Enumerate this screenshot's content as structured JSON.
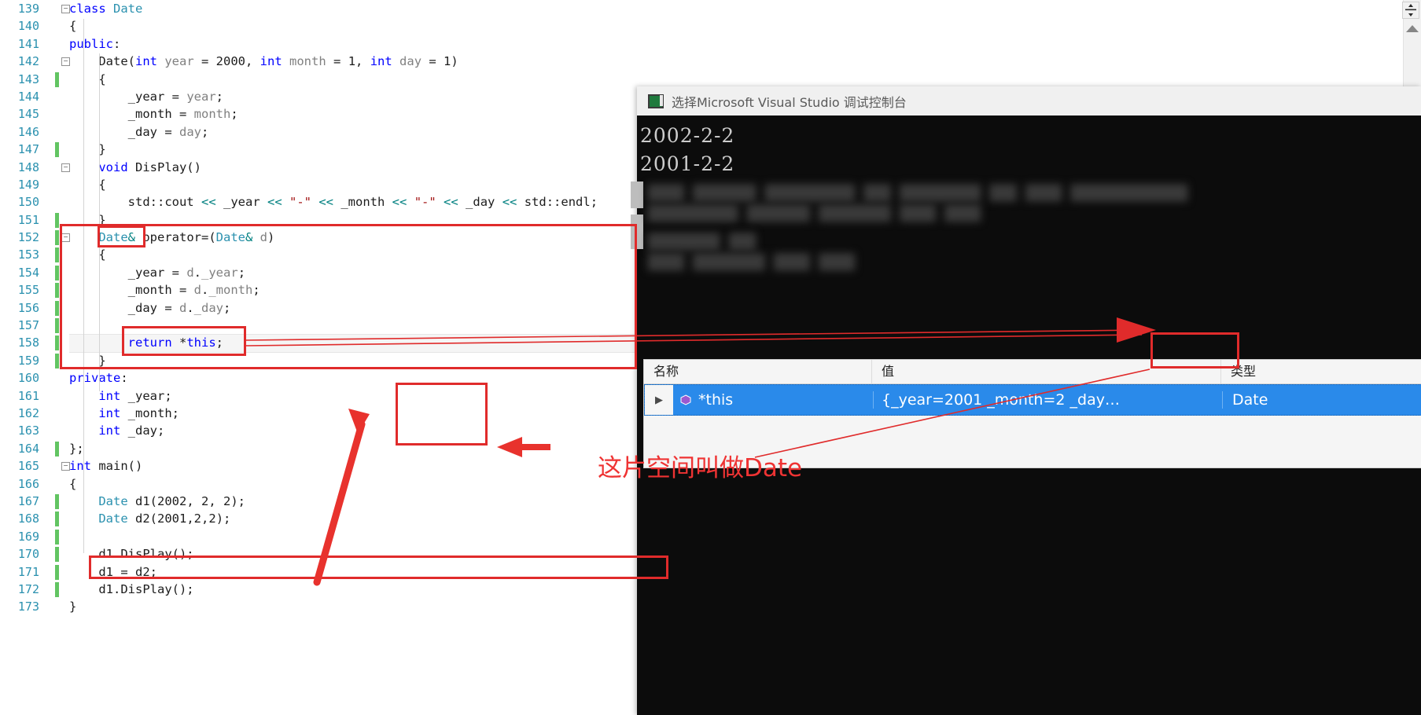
{
  "editor": {
    "first_line_number": 139,
    "lines": [
      {
        "n": 139,
        "fold": "minus",
        "change": false,
        "tokens": [
          {
            "t": "class ",
            "c": "kw"
          },
          {
            "t": "Date",
            "c": "type"
          }
        ]
      },
      {
        "n": 140,
        "fold": null,
        "change": false,
        "tokens": [
          {
            "t": "{",
            "c": "plain"
          }
        ]
      },
      {
        "n": 141,
        "fold": null,
        "change": false,
        "tokens": [
          {
            "t": "public",
            "c": "kw"
          },
          {
            "t": ":",
            "c": "plain"
          }
        ]
      },
      {
        "n": 142,
        "fold": "minus",
        "change": false,
        "indent": 2,
        "tokens": [
          {
            "t": "Date",
            "c": "plain"
          },
          {
            "t": "(",
            "c": "plain"
          },
          {
            "t": "int",
            "c": "kw"
          },
          {
            "t": " ",
            "c": "plain"
          },
          {
            "t": "year",
            "c": "param"
          },
          {
            "t": " = ",
            "c": "plain"
          },
          {
            "t": "2000",
            "c": "num"
          },
          {
            "t": ", ",
            "c": "plain"
          },
          {
            "t": "int",
            "c": "kw"
          },
          {
            "t": " ",
            "c": "plain"
          },
          {
            "t": "month",
            "c": "param"
          },
          {
            "t": " = ",
            "c": "plain"
          },
          {
            "t": "1",
            "c": "num"
          },
          {
            "t": ", ",
            "c": "plain"
          },
          {
            "t": "int",
            "c": "kw"
          },
          {
            "t": " ",
            "c": "plain"
          },
          {
            "t": "day",
            "c": "param"
          },
          {
            "t": " = ",
            "c": "plain"
          },
          {
            "t": "1",
            "c": "num"
          },
          {
            "t": ")",
            "c": "plain"
          }
        ]
      },
      {
        "n": 143,
        "fold": null,
        "change": true,
        "indent": 2,
        "tokens": [
          {
            "t": "{",
            "c": "plain"
          }
        ]
      },
      {
        "n": 144,
        "fold": null,
        "change": false,
        "indent": 4,
        "tokens": [
          {
            "t": "_year",
            "c": "plain"
          },
          {
            "t": " = ",
            "c": "plain"
          },
          {
            "t": "year",
            "c": "param"
          },
          {
            "t": ";",
            "c": "plain"
          }
        ]
      },
      {
        "n": 145,
        "fold": null,
        "change": false,
        "indent": 4,
        "tokens": [
          {
            "t": "_month",
            "c": "plain"
          },
          {
            "t": " = ",
            "c": "plain"
          },
          {
            "t": "month",
            "c": "param"
          },
          {
            "t": ";",
            "c": "plain"
          }
        ]
      },
      {
        "n": 146,
        "fold": null,
        "change": false,
        "indent": 4,
        "tokens": [
          {
            "t": "_day",
            "c": "plain"
          },
          {
            "t": " = ",
            "c": "plain"
          },
          {
            "t": "day",
            "c": "param"
          },
          {
            "t": ";",
            "c": "plain"
          }
        ]
      },
      {
        "n": 147,
        "fold": null,
        "change": true,
        "indent": 2,
        "tokens": [
          {
            "t": "}",
            "c": "plain"
          }
        ]
      },
      {
        "n": 148,
        "fold": "minus",
        "change": false,
        "indent": 2,
        "tokens": [
          {
            "t": "void",
            "c": "kw"
          },
          {
            "t": " DisPlay()",
            "c": "plain"
          }
        ]
      },
      {
        "n": 149,
        "fold": null,
        "change": false,
        "indent": 2,
        "tokens": [
          {
            "t": "{",
            "c": "plain"
          }
        ]
      },
      {
        "n": 150,
        "fold": null,
        "change": false,
        "indent": 4,
        "tokens": [
          {
            "t": "std::cout ",
            "c": "plain"
          },
          {
            "t": "<<",
            "c": "op"
          },
          {
            "t": " _year ",
            "c": "plain"
          },
          {
            "t": "<<",
            "c": "op"
          },
          {
            "t": " ",
            "c": "plain"
          },
          {
            "t": "\"-\"",
            "c": "str"
          },
          {
            "t": " ",
            "c": "plain"
          },
          {
            "t": "<<",
            "c": "op"
          },
          {
            "t": " _month ",
            "c": "plain"
          },
          {
            "t": "<<",
            "c": "op"
          },
          {
            "t": " ",
            "c": "plain"
          },
          {
            "t": "\"-\"",
            "c": "str"
          },
          {
            "t": " ",
            "c": "plain"
          },
          {
            "t": "<<",
            "c": "op"
          },
          {
            "t": " _day ",
            "c": "plain"
          },
          {
            "t": "<<",
            "c": "op"
          },
          {
            "t": " std::endl;",
            "c": "plain"
          }
        ]
      },
      {
        "n": 151,
        "fold": null,
        "change": true,
        "indent": 2,
        "tokens": [
          {
            "t": "}",
            "c": "plain"
          }
        ]
      },
      {
        "n": 152,
        "fold": "minus",
        "change": true,
        "indent": 2,
        "tokens": [
          {
            "t": "Date",
            "c": "type"
          },
          {
            "t": "&",
            "c": "op"
          },
          {
            "t": " operator=(",
            "c": "plain"
          },
          {
            "t": "Date",
            "c": "type"
          },
          {
            "t": "&",
            "c": "op"
          },
          {
            "t": " ",
            "c": "plain"
          },
          {
            "t": "d",
            "c": "param"
          },
          {
            "t": ")",
            "c": "plain"
          }
        ]
      },
      {
        "n": 153,
        "fold": null,
        "change": true,
        "indent": 2,
        "tokens": [
          {
            "t": "{",
            "c": "plain"
          }
        ]
      },
      {
        "n": 154,
        "fold": null,
        "change": true,
        "indent": 4,
        "tokens": [
          {
            "t": "_year",
            "c": "plain"
          },
          {
            "t": " = ",
            "c": "plain"
          },
          {
            "t": "d",
            "c": "param"
          },
          {
            "t": ".",
            "c": "plain"
          },
          {
            "t": "_year",
            "c": "param"
          },
          {
            "t": ";",
            "c": "plain"
          }
        ]
      },
      {
        "n": 155,
        "fold": null,
        "change": true,
        "indent": 4,
        "tokens": [
          {
            "t": "_month",
            "c": "plain"
          },
          {
            "t": " = ",
            "c": "plain"
          },
          {
            "t": "d",
            "c": "param"
          },
          {
            "t": ".",
            "c": "plain"
          },
          {
            "t": "_month",
            "c": "param"
          },
          {
            "t": ";",
            "c": "plain"
          }
        ]
      },
      {
        "n": 156,
        "fold": null,
        "change": true,
        "indent": 4,
        "tokens": [
          {
            "t": "_day",
            "c": "plain"
          },
          {
            "t": " = ",
            "c": "plain"
          },
          {
            "t": "d",
            "c": "param"
          },
          {
            "t": ".",
            "c": "plain"
          },
          {
            "t": "_day",
            "c": "param"
          },
          {
            "t": ";",
            "c": "plain"
          }
        ]
      },
      {
        "n": 157,
        "fold": null,
        "change": true,
        "indent": 0,
        "tokens": []
      },
      {
        "n": 158,
        "fold": null,
        "change": true,
        "indent": 4,
        "current": true,
        "tokens": [
          {
            "t": "return",
            "c": "kw"
          },
          {
            "t": " *",
            "c": "plain"
          },
          {
            "t": "this",
            "c": "kw"
          },
          {
            "t": ";",
            "c": "plain"
          }
        ]
      },
      {
        "n": 159,
        "fold": null,
        "change": true,
        "indent": 2,
        "tokens": [
          {
            "t": "}",
            "c": "plain"
          }
        ]
      },
      {
        "n": 160,
        "fold": null,
        "change": false,
        "tokens": [
          {
            "t": "private",
            "c": "kw"
          },
          {
            "t": ":",
            "c": "plain"
          }
        ]
      },
      {
        "n": 161,
        "fold": null,
        "change": false,
        "indent": 2,
        "tokens": [
          {
            "t": "int",
            "c": "kw"
          },
          {
            "t": " _year;",
            "c": "plain"
          }
        ]
      },
      {
        "n": 162,
        "fold": null,
        "change": false,
        "indent": 2,
        "tokens": [
          {
            "t": "int",
            "c": "kw"
          },
          {
            "t": " _month;",
            "c": "plain"
          }
        ]
      },
      {
        "n": 163,
        "fold": null,
        "change": false,
        "indent": 2,
        "tokens": [
          {
            "t": "int",
            "c": "kw"
          },
          {
            "t": " _day;",
            "c": "plain"
          }
        ]
      },
      {
        "n": 164,
        "fold": null,
        "change": true,
        "tokens": [
          {
            "t": "};",
            "c": "plain"
          }
        ]
      },
      {
        "n": 165,
        "fold": "minus",
        "change": false,
        "tokens": [
          {
            "t": "int",
            "c": "kw"
          },
          {
            "t": " main()",
            "c": "plain"
          }
        ]
      },
      {
        "n": 166,
        "fold": null,
        "change": false,
        "tokens": [
          {
            "t": "{",
            "c": "plain"
          }
        ]
      },
      {
        "n": 167,
        "fold": null,
        "change": true,
        "indent": 2,
        "tokens": [
          {
            "t": "Date",
            "c": "type"
          },
          {
            "t": " d1(",
            "c": "plain"
          },
          {
            "t": "2002",
            "c": "num"
          },
          {
            "t": ", ",
            "c": "plain"
          },
          {
            "t": "2",
            "c": "num"
          },
          {
            "t": ", ",
            "c": "plain"
          },
          {
            "t": "2",
            "c": "num"
          },
          {
            "t": ");",
            "c": "plain"
          }
        ]
      },
      {
        "n": 168,
        "fold": null,
        "change": true,
        "indent": 2,
        "tokens": [
          {
            "t": "Date",
            "c": "type"
          },
          {
            "t": " d2(",
            "c": "plain"
          },
          {
            "t": "2001",
            "c": "num"
          },
          {
            "t": ",",
            "c": "plain"
          },
          {
            "t": "2",
            "c": "num"
          },
          {
            "t": ",",
            "c": "plain"
          },
          {
            "t": "2",
            "c": "num"
          },
          {
            "t": ");",
            "c": "plain"
          }
        ]
      },
      {
        "n": 169,
        "fold": null,
        "change": true,
        "indent": 0,
        "tokens": []
      },
      {
        "n": 170,
        "fold": null,
        "change": true,
        "indent": 2,
        "tokens": [
          {
            "t": "d1.DisPlay();",
            "c": "plain"
          }
        ]
      },
      {
        "n": 171,
        "fold": null,
        "change": true,
        "indent": 2,
        "tokens": [
          {
            "t": "d1 = d2;",
            "c": "plain"
          }
        ]
      },
      {
        "n": 172,
        "fold": null,
        "change": true,
        "indent": 2,
        "tokens": [
          {
            "t": "d1.DisPlay();",
            "c": "plain"
          }
        ]
      },
      {
        "n": 173,
        "fold": null,
        "change": false,
        "tokens": [
          {
            "t": "}",
            "c": "plain"
          }
        ]
      }
    ]
  },
  "scrollbar": {
    "split_icon": "split-view-icon",
    "up_icon": "scroll-up-icon"
  },
  "console": {
    "title": "选择Microsoft Visual Studio 调试控制台",
    "icon": "console-app-icon",
    "output_lines": [
      "2002-2-2",
      "2001-2-2"
    ],
    "blurred_lines": [
      "████ ███████ ██████████ ███ █████████ ███ ████ █████████████",
      "██████████ ███████ ████████ ████ ████",
      "████████ ███",
      "████ ████████ ████ ████"
    ]
  },
  "watch": {
    "columns": [
      "名称",
      "值",
      "类型"
    ],
    "rows": [
      {
        "expander": "▶",
        "icon": "object-variable-icon",
        "name": "*this",
        "value": "{_year=2001 _month=2 _day…",
        "type": "Date",
        "selected": true
      }
    ]
  },
  "annotations": {
    "chinese_note": "这片空间叫做Date",
    "accent_color": "#e02b2b",
    "note_color": "#ef3333"
  }
}
